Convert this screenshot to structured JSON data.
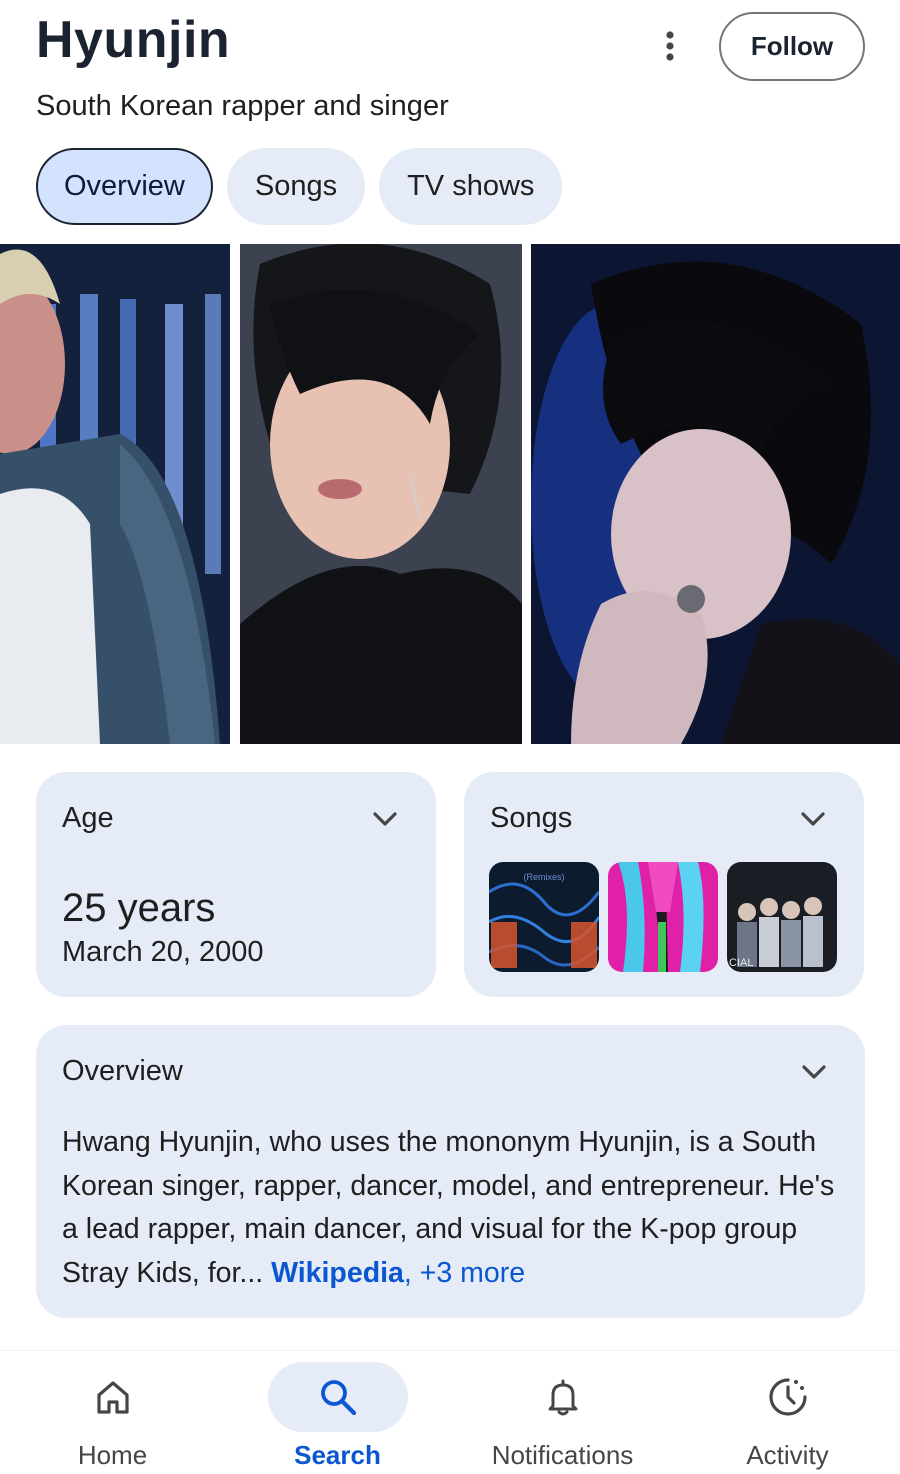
{
  "header": {
    "title": "Hyunjin",
    "subtitle": "South Korean rapper and singer",
    "follow_label": "Follow",
    "more_icon": "more-vert-icon"
  },
  "tabs": [
    {
      "label": "Overview",
      "active": true
    },
    {
      "label": "Songs",
      "active": false
    },
    {
      "label": "TV shows",
      "active": false
    }
  ],
  "gallery": {
    "photos": [
      "photo-stage-performance",
      "photo-portrait-black-jacket",
      "photo-portrait-blue-background"
    ]
  },
  "age_card": {
    "label": "Age",
    "value": "25 years",
    "date": "March 20, 2000"
  },
  "songs_card": {
    "label": "Songs",
    "thumb_text": "(Remixes)",
    "thumb_partial_text": "CIAL"
  },
  "overview": {
    "title": "Overview",
    "text": "Hwang Hyunjin, who uses the mononym Hyunjin, is a South Korean singer, rapper, dancer, model, and entrepreneur. He's a lead rapper, main dancer, and visual for the K-pop group Stray Kids, for",
    "ellipsis": "...",
    "source": "Wikipedia",
    "separator": ",",
    "more": "+3 more"
  },
  "bottom_nav": [
    {
      "label": "Home",
      "icon": "home-icon",
      "active": false
    },
    {
      "label": "Search",
      "icon": "search-icon",
      "active": true
    },
    {
      "label": "Notifications",
      "icon": "bell-icon",
      "active": false
    },
    {
      "label": "Activity",
      "icon": "activity-icon",
      "active": false
    }
  ],
  "colors": {
    "accent": "#0b57d0",
    "card_bg": "#e6ebf8",
    "active_chip_bg": "#d3e3fd"
  }
}
